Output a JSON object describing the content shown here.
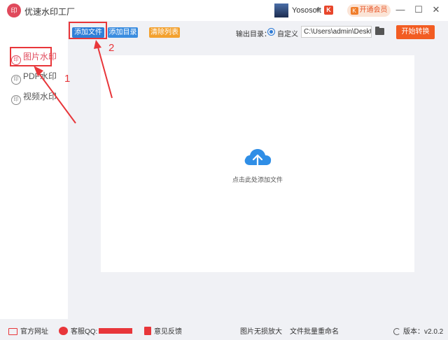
{
  "app": {
    "logo_text": "印",
    "title": "优速水印工厂",
    "user_name": "Yososoft",
    "user_badge": "K",
    "vip_label": "开通会员",
    "vip_icon_text": "K"
  },
  "window_controls": {
    "minimize": "—",
    "restore": "☐",
    "close": "✕"
  },
  "sidebar": {
    "items": [
      {
        "label": "图片水印",
        "icon": "watermark-icon",
        "active": true
      },
      {
        "label": "PDF水印",
        "icon": "watermark-icon",
        "active": false
      },
      {
        "label": "视频水印",
        "icon": "watermark-icon",
        "active": false
      }
    ],
    "icon_glyph": "印"
  },
  "toolbar": {
    "add_file": "添加文件",
    "add_dir": "添加目录",
    "clear_list": "清除列表",
    "output_label": "输出目录：",
    "radio_label": "自定义",
    "output_path": "C:\\Users\\admin\\Desktop",
    "start": "开始转换"
  },
  "main": {
    "drop_hint": "点击此处添加文件"
  },
  "annotations": {
    "num1": "1",
    "num2": "2"
  },
  "footer": {
    "website": "官方网址",
    "qq": "客服QQ:",
    "feedback": "意见反馈",
    "enlarge": "图片无损放大",
    "rename": "文件批量重命名",
    "version": "版本：v2.0.2"
  },
  "colors": {
    "accent": "#e04a5c",
    "add_file_button": "#2f7fd8",
    "add_dir_button": "#3b8de0",
    "clear_button": "#f3a12f",
    "start_button": "#f25c22",
    "annotation": "#e8363a"
  }
}
